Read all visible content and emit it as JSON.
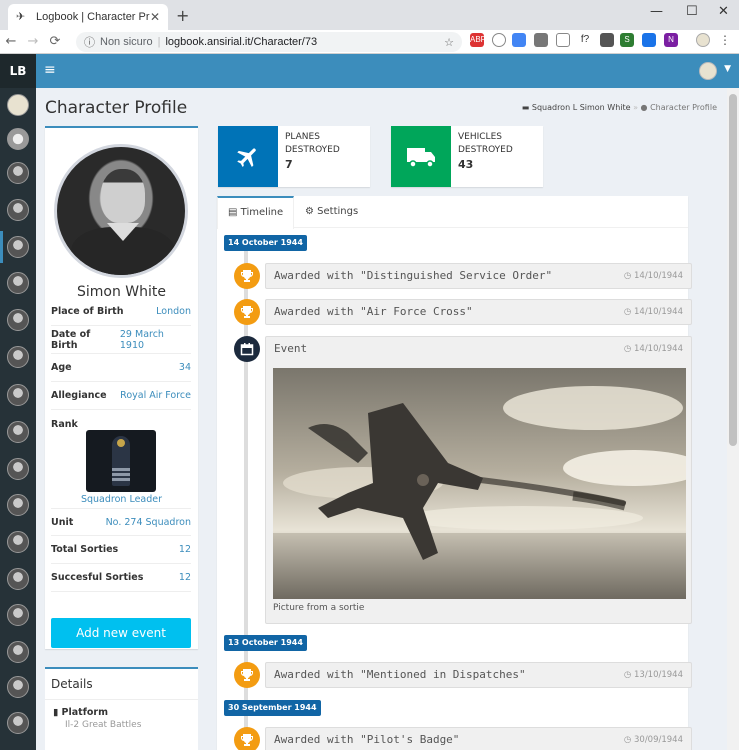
{
  "browser": {
    "tab_title": "Logbook | Character Profile",
    "security": "Non sicuro",
    "url": "logbook.ansirial.it/Character/73"
  },
  "app": {
    "brand": "LB"
  },
  "page": {
    "title": "Character Profile",
    "breadcrumb_parent": "Squadron L Simon White",
    "breadcrumb_current": "Character Profile"
  },
  "profile": {
    "name": "Simon White",
    "fields": [
      {
        "label": "Place of Birth",
        "value": "London"
      },
      {
        "label": "Date of Birth",
        "value": "29 March 1910"
      },
      {
        "label": "Age",
        "value": "34"
      },
      {
        "label": "Allegiance",
        "value": "Royal Air Force"
      }
    ],
    "rank_label": "Rank",
    "rank_value": "Squadron Leader",
    "fields2": [
      {
        "label": "Unit",
        "value": "No. 274 Squadron"
      },
      {
        "label": "Total Sorties",
        "value": "12"
      },
      {
        "label": "Succesful Sorties",
        "value": "12"
      }
    ],
    "add_event": "Add new event"
  },
  "details": {
    "title": "Details",
    "platform_label": "Platform",
    "platform_value": "Il-2 Great Battles"
  },
  "stats": [
    {
      "label": "PLANES DESTROYED",
      "value": "7",
      "color": "#0073b7",
      "icon": "plane-icon"
    },
    {
      "label": "VEHICLES DESTROYED",
      "value": "43",
      "color": "#00a65a",
      "icon": "truck-icon"
    }
  ],
  "tabs": {
    "timeline": "Timeline",
    "settings": "Settings"
  },
  "timeline": {
    "d1": "14 October 1944",
    "e1": {
      "title": "Awarded with \"Distinguished Service Order\"",
      "time": "14/10/1944"
    },
    "e2": {
      "title": "Awarded with \"Air Force Cross\"",
      "time": "14/10/1944"
    },
    "e3": {
      "title": "Event",
      "time": "14/10/1944",
      "caption": "Picture from a sortie"
    },
    "d2": "13 October 1944",
    "e4": {
      "title": "Awarded with \"Mentioned in Dispatches\"",
      "time": "13/10/1944"
    },
    "d3": "30 September 1944",
    "e5": {
      "title": "Awarded with \"Pilot's Badge\"",
      "time": "30/09/1944"
    }
  }
}
